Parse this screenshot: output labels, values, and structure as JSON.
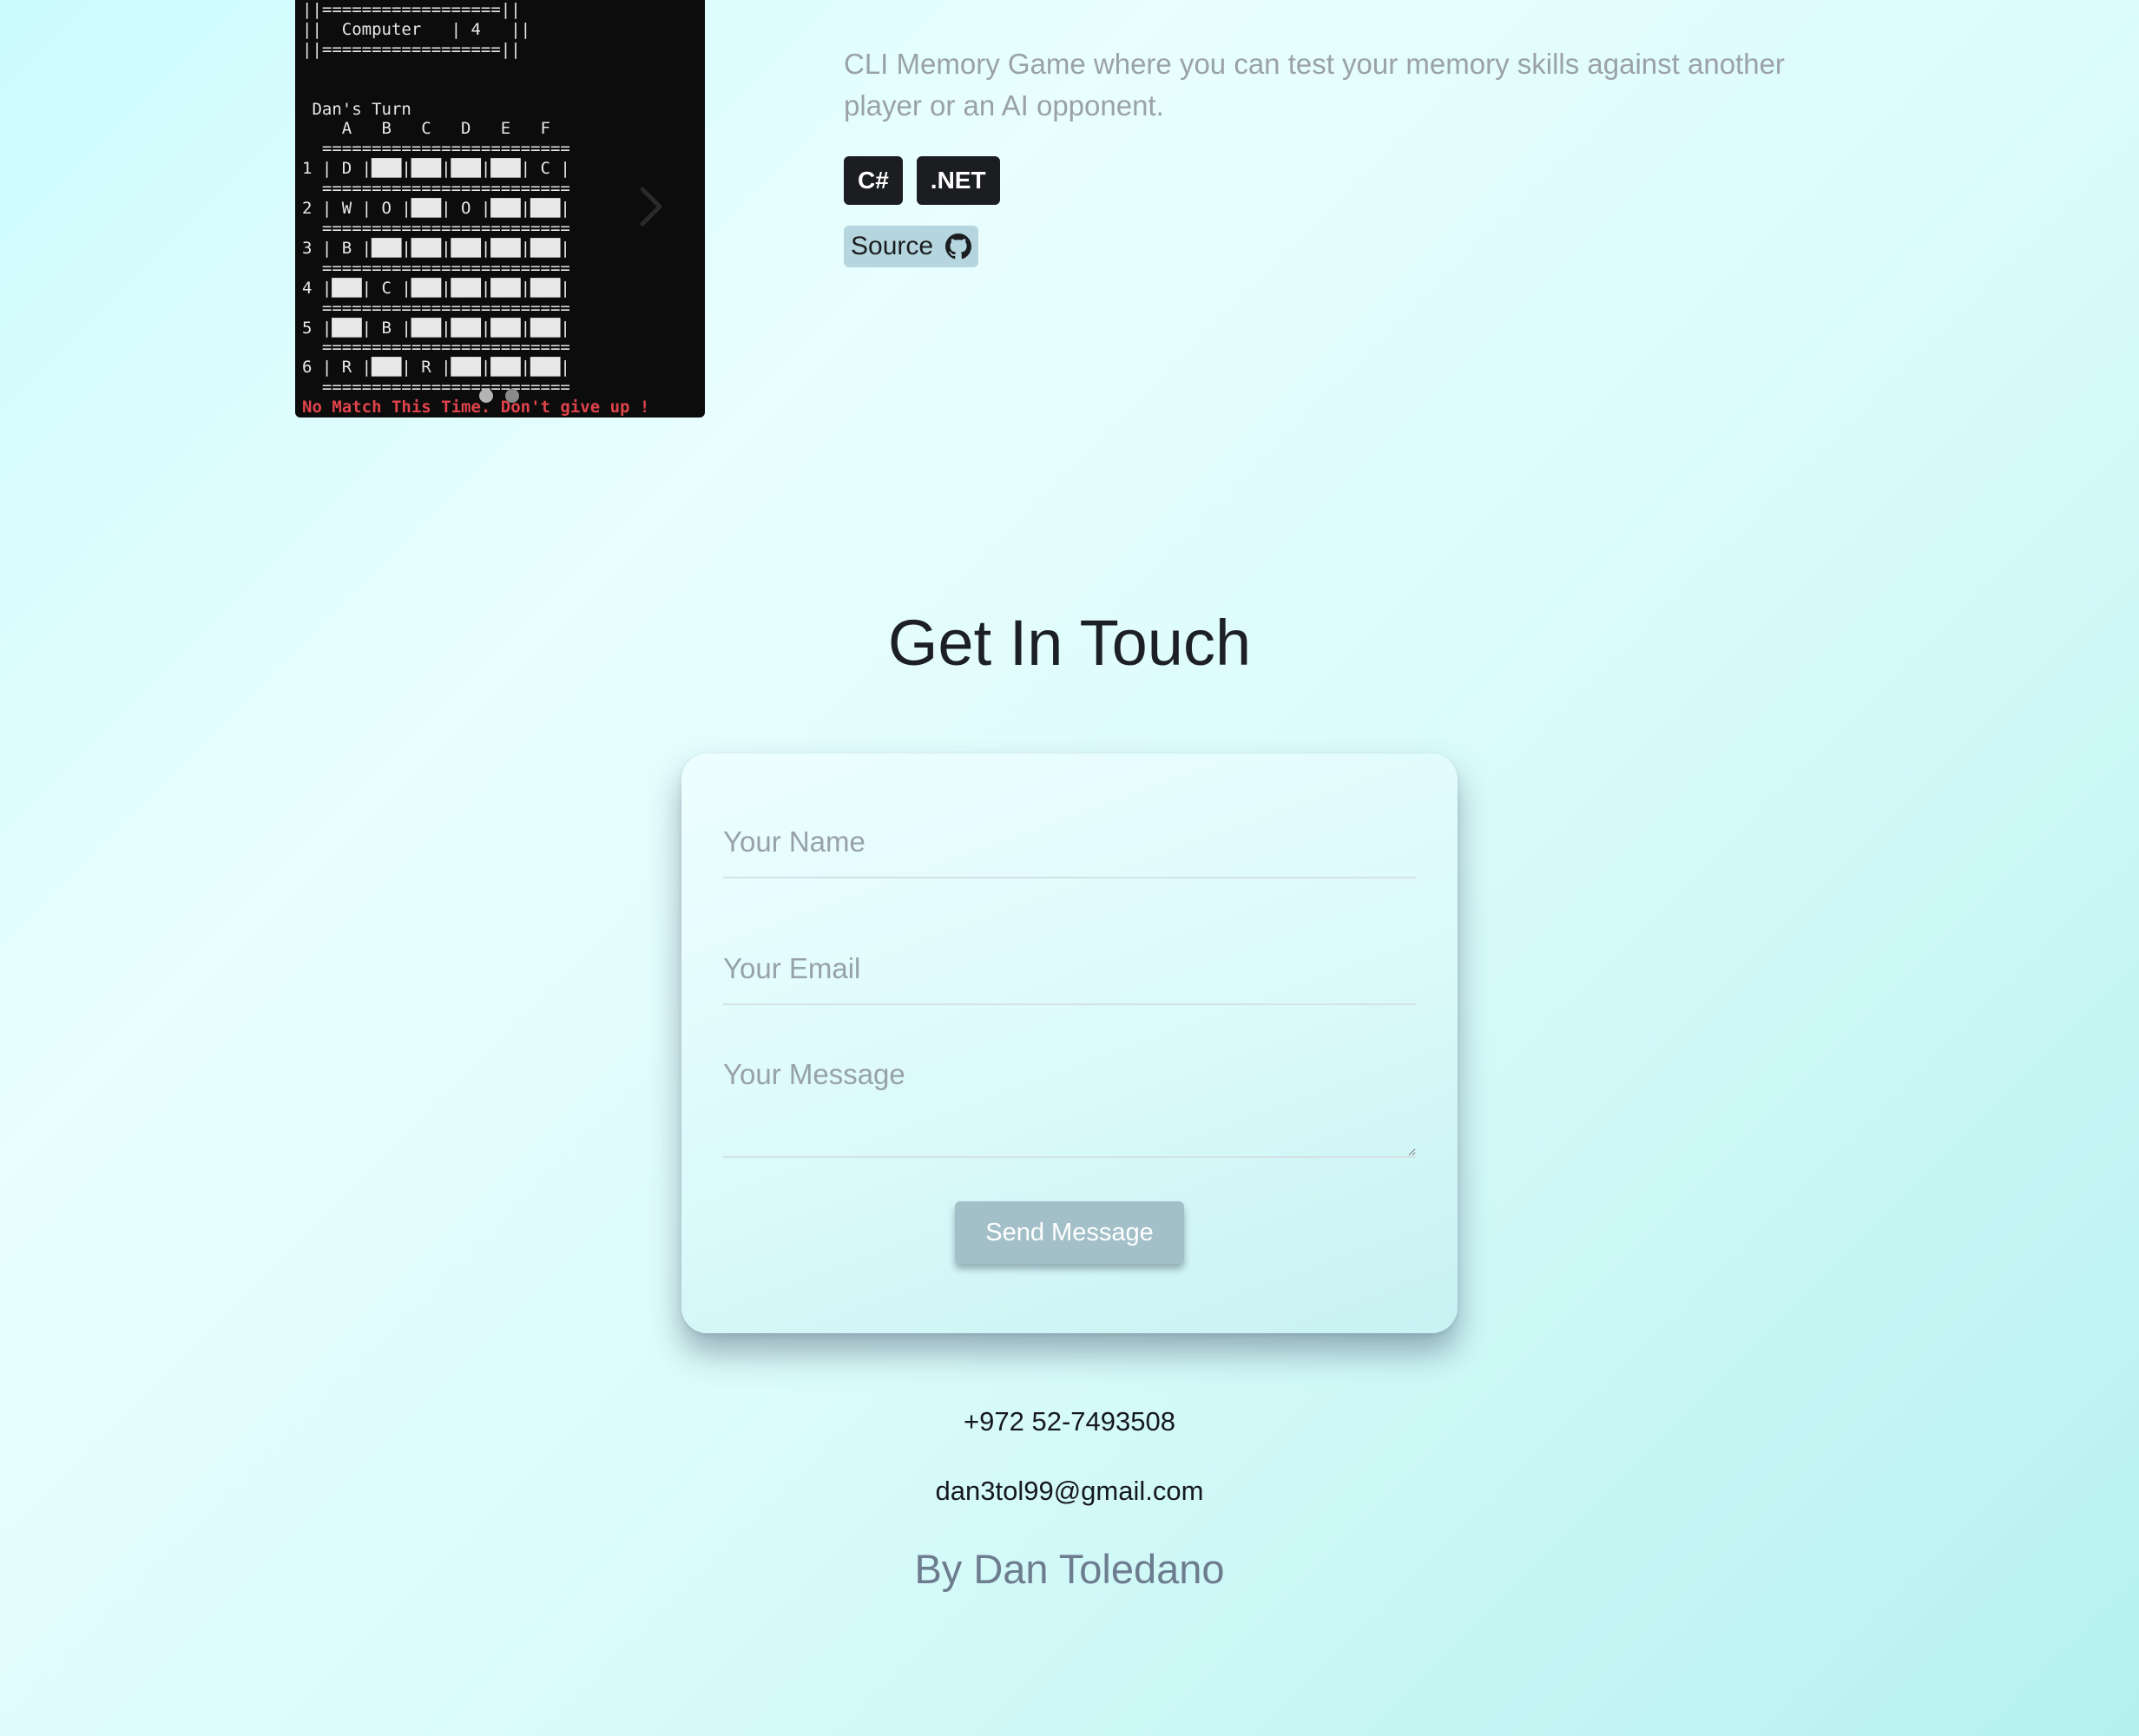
{
  "project": {
    "screenshot_text": {
      "lines": [
        "||==================||",
        "||  Computer   | 4   ||",
        "||==================||",
        "",
        "",
        " Dan's Turn",
        "    A   B   C   D   E   F",
        "  =========================",
        "1 | D |███|███|███|███| C |",
        "  =========================",
        "2 | W | O |███| O |███|███|",
        "  =========================",
        "3 | B |███|███|███|███|███|",
        "  =========================",
        "4 |███| C |███|███|███|███|",
        "  =========================",
        "5 |███| B |███|███|███|███|",
        "  =========================",
        "6 | R |███| R |███|███|███|",
        "  ========================="
      ],
      "status": "No Match This Time. Don't give up !"
    },
    "description": "CLI Memory Game where you can test your memory skills against another player or an AI opponent.",
    "tags": [
      "C#",
      ".NET"
    ],
    "source_label": "Source",
    "carousel": {
      "next_icon": "chevron-right-icon",
      "slide_count": 2,
      "active_slide": 1
    }
  },
  "contact": {
    "title": "Get In Touch",
    "name_placeholder": "Your Name",
    "email_placeholder": "Your Email",
    "message_placeholder": "Your Message",
    "send_label": "Send Message",
    "phone": "+972 52-7493508",
    "email": "dan3tol99@gmail.com"
  },
  "footer": {
    "credit": "By Dan Toledano"
  },
  "colors": {
    "tag_bg": "#1b1d20",
    "source_bg": "#b5d6de",
    "button_bg": "#a3c0c8",
    "status_red": "#e0434b",
    "credit_text": "#6d7c8f"
  }
}
